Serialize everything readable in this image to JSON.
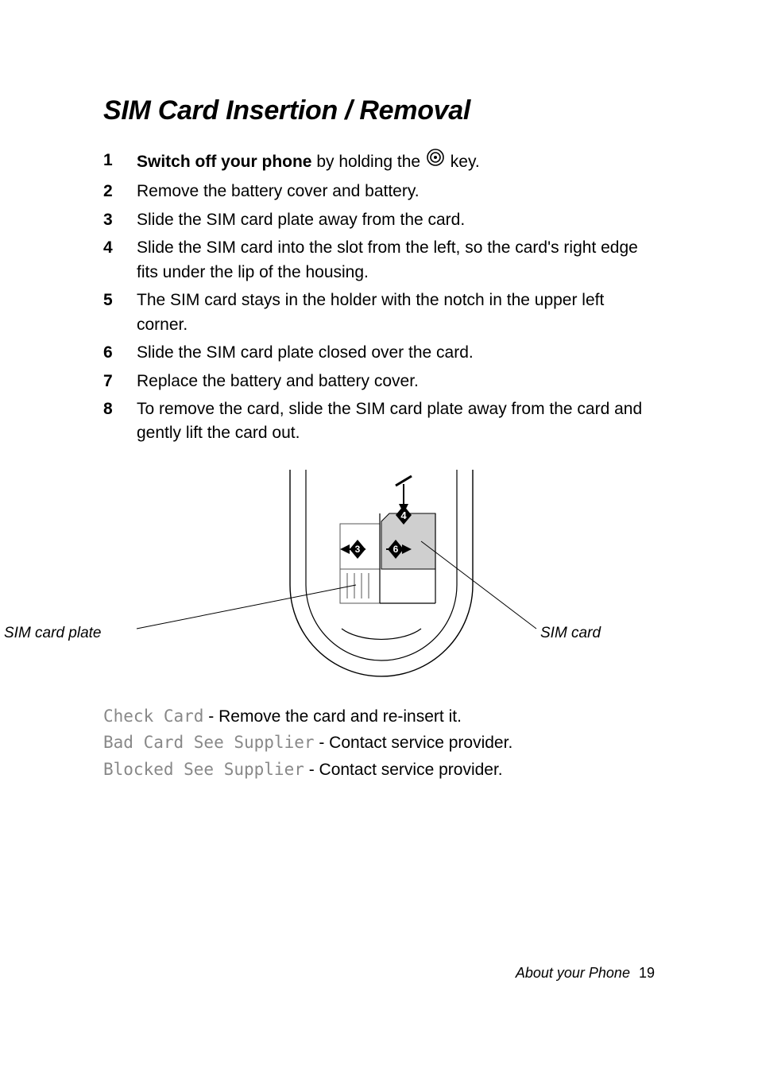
{
  "title": "SIM Card Insertion / Removal",
  "steps": [
    {
      "pre_bold": "Switch off your phone",
      "pre_text": " by holding the ",
      "has_icon": true,
      "post_text": " key."
    },
    {
      "text": "Remove the battery cover and battery."
    },
    {
      "text": "Slide the SIM card plate away from the card."
    },
    {
      "text": "Slide the SIM card into the slot from the left, so the card's right edge fits under the lip of the housing."
    },
    {
      "text": "The SIM card stays in the holder with the notch in the upper left corner."
    },
    {
      "text": "Slide the SIM card plate closed over the card."
    },
    {
      "text": "Replace the battery and battery cover."
    },
    {
      "text": "To remove the card, slide the SIM card plate away from the card and gently lift the card out."
    }
  ],
  "diagram": {
    "left_label": "SIM card plate",
    "right_label": "SIM card",
    "callouts": [
      "4",
      "3",
      "6"
    ]
  },
  "messages": [
    {
      "lcd": "Check Card",
      "text": " - Remove the card and re-insert it."
    },
    {
      "lcd": "Bad Card See Supplier",
      "text": " - Contact service provider."
    },
    {
      "lcd": "Blocked See Supplier",
      "text": " - Contact service provider."
    }
  ],
  "footer": {
    "section": "About your Phone",
    "page": "19"
  }
}
